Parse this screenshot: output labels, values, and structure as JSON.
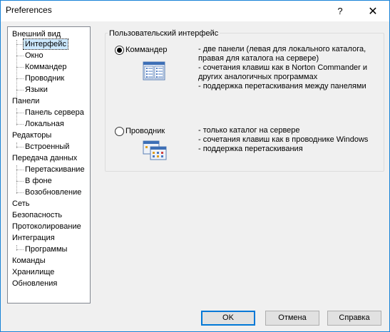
{
  "window": {
    "title": "Preferences",
    "help_glyph": "?",
    "close_glyph": "✕"
  },
  "tree": [
    {
      "label": "Внешний вид"
    },
    {
      "label": "Интерфейс",
      "selected": true
    },
    {
      "label": "Окно"
    },
    {
      "label": "Коммандер"
    },
    {
      "label": "Проводник"
    },
    {
      "label": "Языки"
    },
    {
      "label": "Панели"
    },
    {
      "label": "Панель сервера"
    },
    {
      "label": "Локальная"
    },
    {
      "label": "Редакторы"
    },
    {
      "label": "Встроенный"
    },
    {
      "label": "Передача данных"
    },
    {
      "label": "Перетаскивание"
    },
    {
      "label": "В фоне"
    },
    {
      "label": "Возобновление"
    },
    {
      "label": "Сеть"
    },
    {
      "label": "Безопасность"
    },
    {
      "label": "Протоколирование"
    },
    {
      "label": "Интеграция"
    },
    {
      "label": "Программы"
    },
    {
      "label": "Команды"
    },
    {
      "label": "Хранилище"
    },
    {
      "label": "Обновления"
    }
  ],
  "group": {
    "legend": "Пользовательский интерфейс",
    "options": [
      {
        "label": "Коммандер",
        "checked": true,
        "icon": "commander-icon",
        "lines": [
          "- две панели (левая для локального каталога,",
          "правая для каталога на сервере)",
          "- сочетания клавиш как в Norton Commander и",
          "других аналогичных программах",
          "- поддержка перетаскивания между панелями"
        ]
      },
      {
        "label": "Проводник",
        "checked": false,
        "icon": "explorer-icon",
        "lines": [
          "- только каталог на сервере",
          "- сочетания клавиш как в проводнике Windows",
          "- поддержка перетаскивания"
        ]
      }
    ]
  },
  "buttons": {
    "ok": "OK",
    "cancel": "Отмена",
    "help": "Справка"
  }
}
